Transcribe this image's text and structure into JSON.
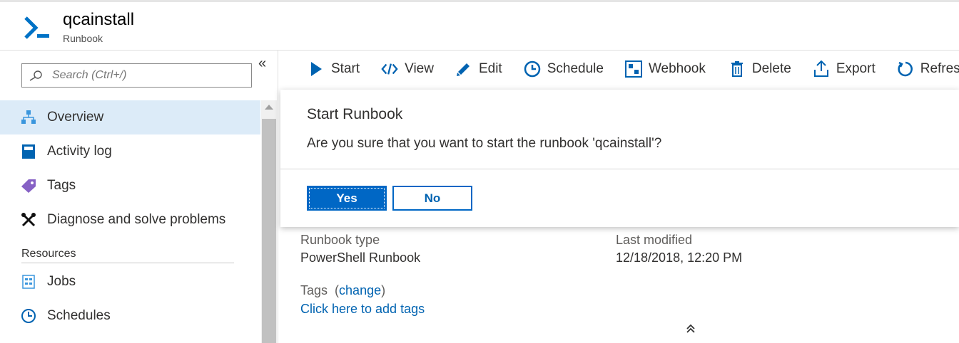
{
  "header": {
    "title": "qcainstall",
    "subtitle": "Runbook"
  },
  "sidebar": {
    "search_placeholder": "Search (Ctrl+/)",
    "collapse_glyph": "«",
    "items": [
      {
        "label": "Overview",
        "icon": "overview-icon",
        "active": true
      },
      {
        "label": "Activity log",
        "icon": "activity-log-icon"
      },
      {
        "label": "Tags",
        "icon": "tag-icon"
      },
      {
        "label": "Diagnose and solve problems",
        "icon": "wrench-icon"
      }
    ],
    "section_resources": "Resources",
    "resource_items": [
      {
        "label": "Jobs",
        "icon": "jobs-icon"
      },
      {
        "label": "Schedules",
        "icon": "clock-icon"
      }
    ]
  },
  "toolbar": {
    "start": "Start",
    "view": "View",
    "edit": "Edit",
    "schedule": "Schedule",
    "webhook": "Webhook",
    "delete": "Delete",
    "export": "Export",
    "refresh": "Refresh"
  },
  "dialog": {
    "title": "Start Runbook",
    "message": "Are you sure that you want to start the runbook 'qcainstall'?",
    "yes_label": "Yes",
    "no_label": "No"
  },
  "essentials": {
    "runbook_type_label": "Runbook type",
    "runbook_type_value": "PowerShell Runbook",
    "last_modified_label": "Last modified",
    "last_modified_value": "12/18/2018, 12:20 PM",
    "tags_label": "Tags",
    "tags_change": "change",
    "tags_open": "(",
    "tags_close": ")",
    "tags_add_link": "Click here to add tags",
    "collapse_glyph": "⌃"
  },
  "colors": {
    "accent": "#0067c5",
    "active_bg": "#dcebf8",
    "link": "#0063b1"
  }
}
